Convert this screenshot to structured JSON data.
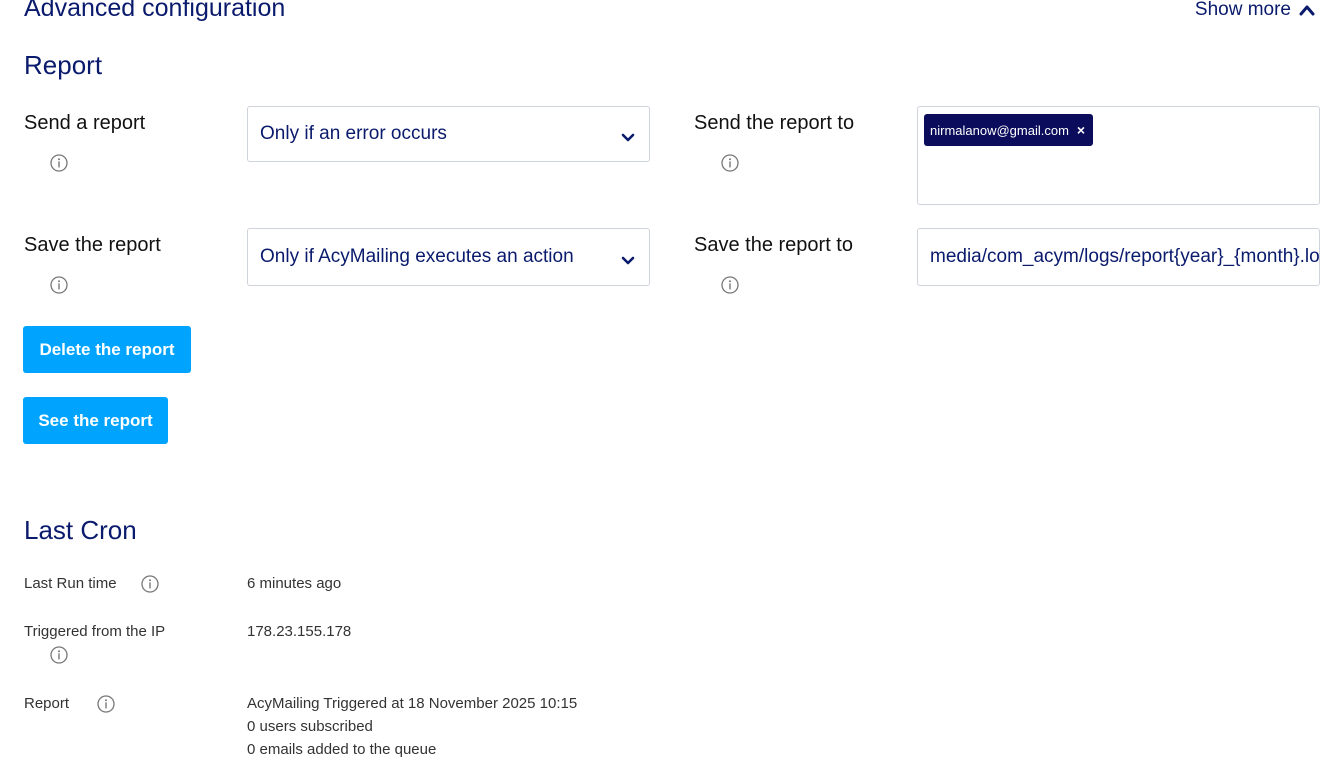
{
  "header": {
    "title": "Advanced configuration",
    "show_more_label": "Show more",
    "show_more_icon": "chevron-up-icon"
  },
  "report": {
    "section_title": "Report",
    "send_report_label": "Send a report",
    "send_report_value": "Only if an error occurs",
    "send_report_to_label": "Send the report to",
    "send_report_to_tags": [
      "nirmalanow@gmail.com"
    ],
    "save_report_label": "Save the report",
    "save_report_value": "Only if AcyMailing executes an action",
    "save_report_to_label": "Save the report to",
    "save_report_to_value": "media/com_acym/logs/report{year}_{month}.log",
    "delete_button_label": "Delete the report",
    "see_button_label": "See the report"
  },
  "last_cron": {
    "section_title": "Last Cron",
    "last_run_label": "Last Run time",
    "last_run_value": "6 minutes ago",
    "triggered_ip_label": "Triggered from the IP",
    "triggered_ip_value": "178.23.155.178",
    "report_label": "Report",
    "report_lines": [
      "AcyMailing Triggered at 18 November 2025 10:15",
      "0 users subscribed",
      "0 emails added to the queue"
    ]
  },
  "colors": {
    "accent_blue": "#00a4ff",
    "navy_text": "#0a1a6c",
    "tag_bg": "#0b0d5c"
  }
}
